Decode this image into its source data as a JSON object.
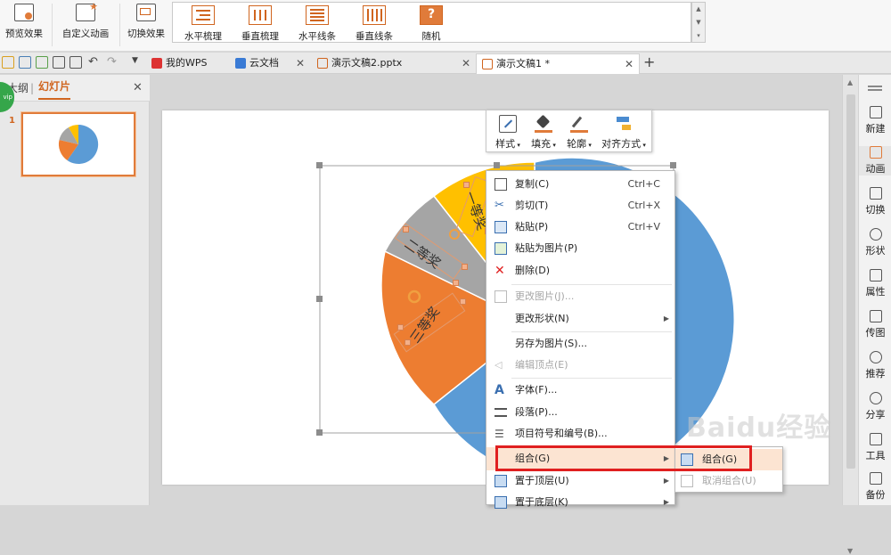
{
  "ribbon": {
    "preview_label": "预览效果",
    "custom_anim_label": "自定义动画",
    "transition_label": "切换效果",
    "gallery": [
      "水平梳理",
      "垂直梳理",
      "水平线条",
      "垂直线条",
      "随机"
    ]
  },
  "tabs": [
    {
      "label": "我的WPS"
    },
    {
      "label": "云文档"
    },
    {
      "label": "演示文稿2.pptx"
    },
    {
      "label": "演示文稿1 *"
    }
  ],
  "left_pane": {
    "outline_tab": "大纲",
    "slides_tab": "幻灯片",
    "slide_number": "1"
  },
  "mini_toolbar": [
    "样式",
    "填充",
    "轮廓",
    "对齐方式"
  ],
  "context_menu": [
    {
      "label": "复制(C)",
      "shortcut": "Ctrl+C"
    },
    {
      "label": "剪切(T)",
      "shortcut": "Ctrl+X"
    },
    {
      "label": "粘贴(P)",
      "shortcut": "Ctrl+V"
    },
    {
      "label": "粘贴为图片(P)",
      "shortcut": ""
    },
    {
      "label": "删除(D)",
      "shortcut": ""
    },
    {
      "label": "更改图片(J)...",
      "shortcut": ""
    },
    {
      "label": "更改形状(N)",
      "shortcut": ""
    },
    {
      "label": "另存为图片(S)...",
      "shortcut": ""
    },
    {
      "label": "编辑顶点(E)",
      "shortcut": ""
    },
    {
      "label": "字体(F)...",
      "shortcut": ""
    },
    {
      "label": "段落(P)...",
      "shortcut": ""
    },
    {
      "label": "项目符号和编号(B)...",
      "shortcut": ""
    },
    {
      "label": "组合(G)",
      "shortcut": ""
    },
    {
      "label": "置于顶层(U)",
      "shortcut": ""
    },
    {
      "label": "置于底层(K)",
      "shortcut": ""
    }
  ],
  "submenu": [
    "组合(G)",
    "取消组合(U)"
  ],
  "right_sidebar": [
    "新建",
    "动画",
    "切换",
    "形状",
    "属性",
    "传图",
    "推荐",
    "分享",
    "工具",
    "备份"
  ],
  "slide": {
    "labels": [
      "一等奖",
      "二等奖",
      "三等奖"
    ]
  },
  "watermark": "Baidu经验",
  "colors": {
    "accent": "#e07b3a",
    "pie_blue": "#5b9bd5",
    "pie_orange": "#ed7d31",
    "pie_gray": "#a5a5a5",
    "pie_yellow": "#ffc000",
    "highlight_box": "#e02020"
  }
}
